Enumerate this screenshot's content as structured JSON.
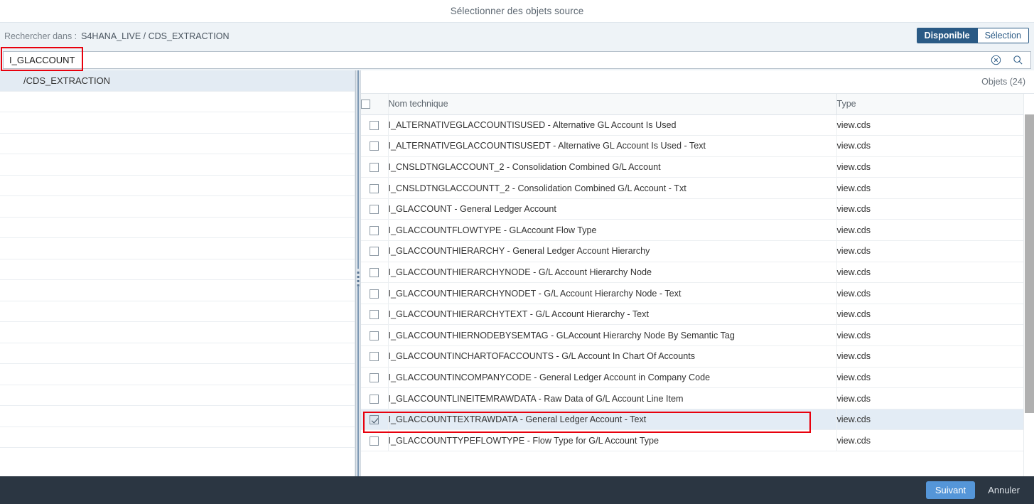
{
  "window": {
    "title": "Sélectionner des objets source"
  },
  "scope": {
    "label": "Rechercher dans :",
    "value": "S4HANA_LIVE / CDS_EXTRACTION"
  },
  "view_toggle": {
    "available_label": "Disponible",
    "selection_label": "Sélection",
    "active": "Disponible",
    "active_bg": "#2a5a85"
  },
  "search": {
    "value": "I_GLACCOUNT",
    "placeholder": "",
    "clear_icon": "clear-circle-icon",
    "search_icon": "search-icon"
  },
  "left_panel": {
    "selected_folder": "/CDS_EXTRACTION",
    "empty_rows": 17
  },
  "objects": {
    "count_label": "Objets (24)",
    "columns": [
      "Nom technique",
      "Type"
    ],
    "header_select_all_checked": false,
    "rows": [
      {
        "checked": false,
        "name": "I_ALTERNATIVEGLACCOUNTISUSED - Alternative GL Account Is Used",
        "type": "view.cds"
      },
      {
        "checked": false,
        "name": "I_ALTERNATIVEGLACCOUNTISUSEDT - Alternative GL Account Is Used - Text",
        "type": "view.cds"
      },
      {
        "checked": false,
        "name": "I_CNSLDTNGLACCOUNT_2 - Consolidation Combined G/L Account",
        "type": "view.cds"
      },
      {
        "checked": false,
        "name": "I_CNSLDTNGLACCOUNTT_2 - Consolidation Combined G/L Account - Txt",
        "type": "view.cds"
      },
      {
        "checked": false,
        "name": "I_GLACCOUNT - General Ledger Account",
        "type": "view.cds"
      },
      {
        "checked": false,
        "name": "I_GLACCOUNTFLOWTYPE - GLAccount Flow Type",
        "type": "view.cds"
      },
      {
        "checked": false,
        "name": "I_GLACCOUNTHIERARCHY - General Ledger Account Hierarchy",
        "type": "view.cds"
      },
      {
        "checked": false,
        "name": "I_GLACCOUNTHIERARCHYNODE - G/L Account Hierarchy Node",
        "type": "view.cds"
      },
      {
        "checked": false,
        "name": "I_GLACCOUNTHIERARCHYNODET - G/L Account Hierarchy Node - Text",
        "type": "view.cds"
      },
      {
        "checked": false,
        "name": "I_GLACCOUNTHIERARCHYTEXT - G/L Account Hierarchy - Text",
        "type": "view.cds"
      },
      {
        "checked": false,
        "name": "I_GLACCOUNTHIERNODEBYSEMTAG - GLAccount Hierarchy Node By Semantic Tag",
        "type": "view.cds"
      },
      {
        "checked": false,
        "name": "I_GLACCOUNTINCHARTOFACCOUNTS - G/L Account In Chart Of Accounts",
        "type": "view.cds"
      },
      {
        "checked": false,
        "name": "I_GLACCOUNTINCOMPANYCODE - General Ledger Account in Company Code",
        "type": "view.cds"
      },
      {
        "checked": false,
        "name": "I_GLACCOUNTLINEITEMRAWDATA - Raw Data of G/L Account Line Item",
        "type": "view.cds"
      },
      {
        "checked": true,
        "name": "I_GLACCOUNTTEXTRAWDATA - General Ledger Account - Text",
        "type": "view.cds"
      },
      {
        "checked": false,
        "name": "I_GLACCOUNTTYPEFLOWTYPE - Flow Type for G/L Account Type",
        "type": "view.cds"
      }
    ]
  },
  "footer": {
    "next_label": "Suivant",
    "cancel_label": "Annuler",
    "next_bg": "#5596d8"
  },
  "annotations": {
    "highlight_color": "#e8000d"
  }
}
